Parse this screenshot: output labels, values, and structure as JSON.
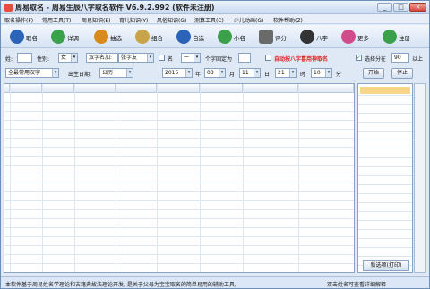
{
  "window": {
    "title": "周易取名 - 周易生辰八字取名软件 V6.9.2.992 (软件未注册)",
    "controls": [
      "_",
      "□",
      "×"
    ]
  },
  "menu": [
    "取名操作(F)",
    "常用工具(T)",
    "周易知识(E)",
    "育儿知识(Y)",
    "风俗知识(G)",
    "测算工具(C)",
    "少儿动画(G)",
    "软件帮助(Z)"
  ],
  "toolbar": [
    {
      "label": "取名",
      "icon": "person-icon",
      "color": "#2a63b8"
    },
    {
      "label": "详调",
      "icon": "detail-icon",
      "color": "#3aa04a"
    },
    {
      "label": "抽选",
      "icon": "select-icon",
      "color": "#d98a1c"
    },
    {
      "label": "组合",
      "icon": "combine-icon",
      "color": "#c9a34a"
    },
    {
      "label": "自选",
      "icon": "self-select-icon",
      "color": "#2a63b8"
    },
    {
      "label": "小名",
      "icon": "nickname-icon",
      "color": "#3aa04a"
    },
    {
      "label": "评分",
      "icon": "score-icon",
      "color": "#6a6a6a"
    },
    {
      "label": "八字",
      "icon": "bazi-icon",
      "color": "#333333"
    },
    {
      "label": "更多",
      "icon": "more-icon",
      "color": "#d04c8a"
    },
    {
      "label": "注册",
      "icon": "register-icon",
      "color": "#3aa04a"
    }
  ],
  "form": {
    "surname_label": "姓:",
    "gender_label": "性别:",
    "gender_value": "女",
    "name_type_value": "双字名加:",
    "name_mode_value": "张字友",
    "fixed_checkbox_label": "名",
    "fixed_select_value": "一",
    "fixed_pos_label": "个字固定为",
    "auto_bazi_label": "自动按八字喜用神取名",
    "score_checkbox_label": "选择分在",
    "score_value": "90",
    "score_suffix": "以上",
    "charset_value": "全最常用汉字",
    "birth_label": "出生日期:",
    "calendar_value": "公历",
    "year_value": "2015",
    "year_unit": "年",
    "month_value": "03",
    "month_unit": "月",
    "day_value": "11",
    "day_unit": "日",
    "hour_value": "21",
    "hour_unit": "时",
    "minute_value": "10",
    "minute_unit": "分",
    "start_button": "开始",
    "stop_button": "停止"
  },
  "overlay_button": "新选项(打印)",
  "status": {
    "left": "本软件基于周易姓名学理论和古籍典故法理论开发, 是关于父母为宝宝取名的简单易用的辅助工具。",
    "right": "双击姓名可查看详细解释"
  }
}
